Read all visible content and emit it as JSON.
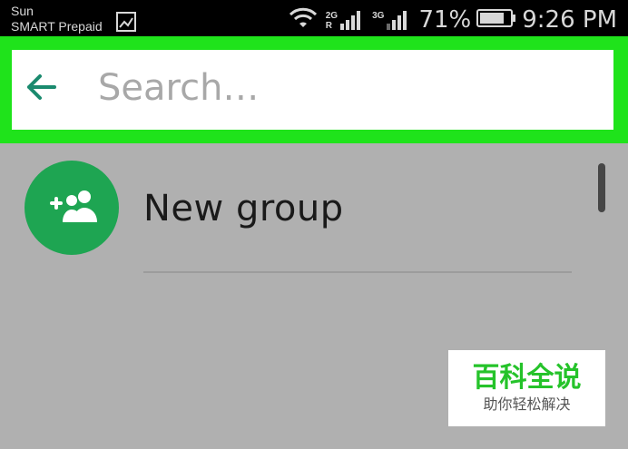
{
  "status_bar": {
    "carrier_line1": "Sun",
    "carrier_line2": "SMART Prepaid",
    "network1": "2G",
    "network1_sub": "R",
    "network2": "3G",
    "battery_percent": "71%",
    "time": "9:26 PM",
    "icons": [
      "sim-icon",
      "wifi-icon",
      "signal-icon",
      "battery-icon"
    ]
  },
  "search": {
    "placeholder": "Search…",
    "value": "",
    "highlight_color": "#1fe31b"
  },
  "list": {
    "items": [
      {
        "label": "New group",
        "icon": "add-group-icon",
        "avatar_color": "#1ea552"
      }
    ]
  },
  "watermark": {
    "title": "百科全说",
    "subtitle": "助你轻松解决"
  }
}
